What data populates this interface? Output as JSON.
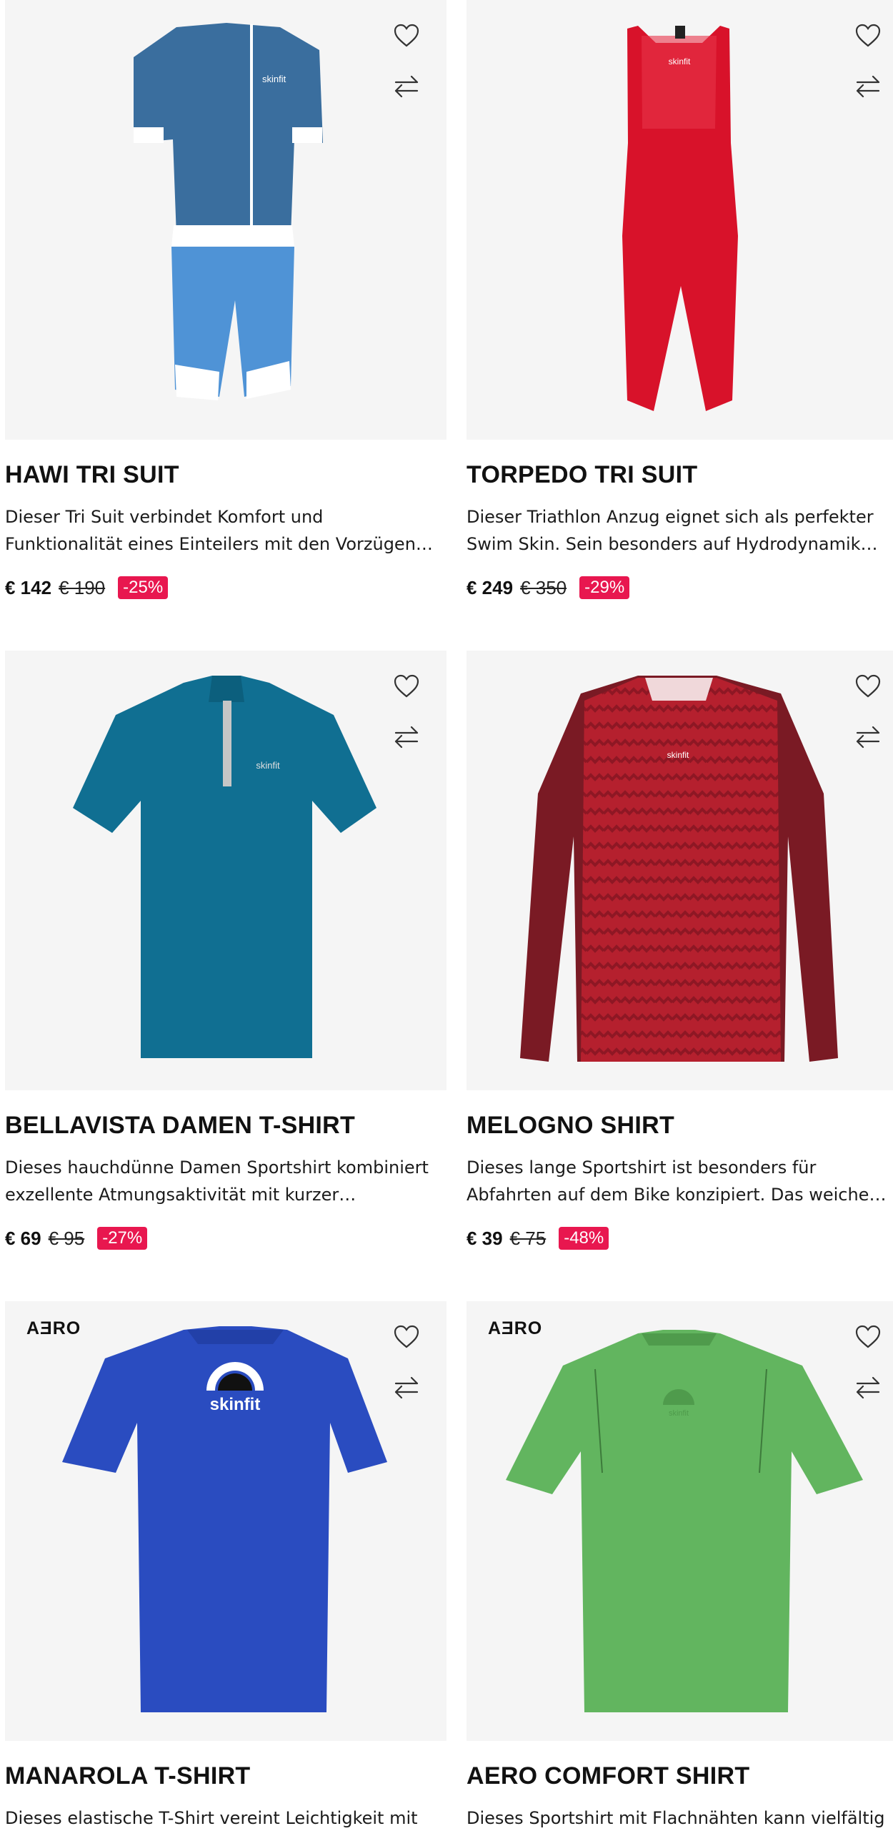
{
  "products": [
    {
      "name": "HAWI TRI SUIT",
      "description": "Dieser Tri Suit verbindet Komfort und Funktionalität eines Einteilers mit den Vorzügen eines Zweiteilers. Di...",
      "price": "€ 142",
      "old_price": "€ 190",
      "discount": "-25%",
      "badge": "",
      "image_icon": "tri-suit-blue",
      "colors": {
        "primary": "#3a6e9e",
        "secondary": "#4f93d6"
      }
    },
    {
      "name": "TORPEDO TRI SUIT",
      "description": "Dieser Triathlon Anzug eignet sich als perfekter Swim Skin. Sein besonders auf Hydrodynamik ausgelegtes...",
      "price": "€ 249",
      "old_price": "€ 350",
      "discount": "-29%",
      "badge": "",
      "image_icon": "swim-skin-red",
      "colors": {
        "primary": "#d8122a"
      }
    },
    {
      "name": "BELLAVISTA DAMEN T-SHIRT",
      "description": "Dieses hauchdünne Damen Sportshirt kombiniert exzellente Atmungsaktivität mit kurzer Trocknungszei...",
      "price": "€ 69",
      "old_price": "€ 95",
      "discount": "-27%",
      "badge": "",
      "image_icon": "zip-tshirt-petrol",
      "colors": {
        "primary": "#106f92"
      }
    },
    {
      "name": "MELOGNO SHIRT",
      "description": "Dieses lange Sportshirt ist besonders für Abfahrten auf dem Bike konzipiert. Das weiche Funktionsmaterial gi...",
      "price": "€ 39",
      "old_price": "€ 75",
      "discount": "-48%",
      "badge": "",
      "image_icon": "longsleeve-red",
      "colors": {
        "primary": "#b5202e",
        "secondary": "#7a1a24"
      }
    },
    {
      "name": "MANAROLA T-SHIRT",
      "description": "Dieses elastische T-Shirt vereint Leichtigkeit mit",
      "price": "",
      "old_price": "",
      "discount": "",
      "badge": "AƎRO",
      "image_icon": "tshirt-blue",
      "colors": {
        "primary": "#2a4cc0"
      }
    },
    {
      "name": "AERO COMFORT SHIRT",
      "description": "Dieses Sportshirt mit Flachnähten kann vielfältig",
      "price": "",
      "old_price": "",
      "discount": "",
      "badge": "AƎRO",
      "image_icon": "tshirt-green",
      "colors": {
        "primary": "#62b55f"
      }
    }
  ],
  "brand_logo_text": "skinfit",
  "accent_color": "#e8174f"
}
